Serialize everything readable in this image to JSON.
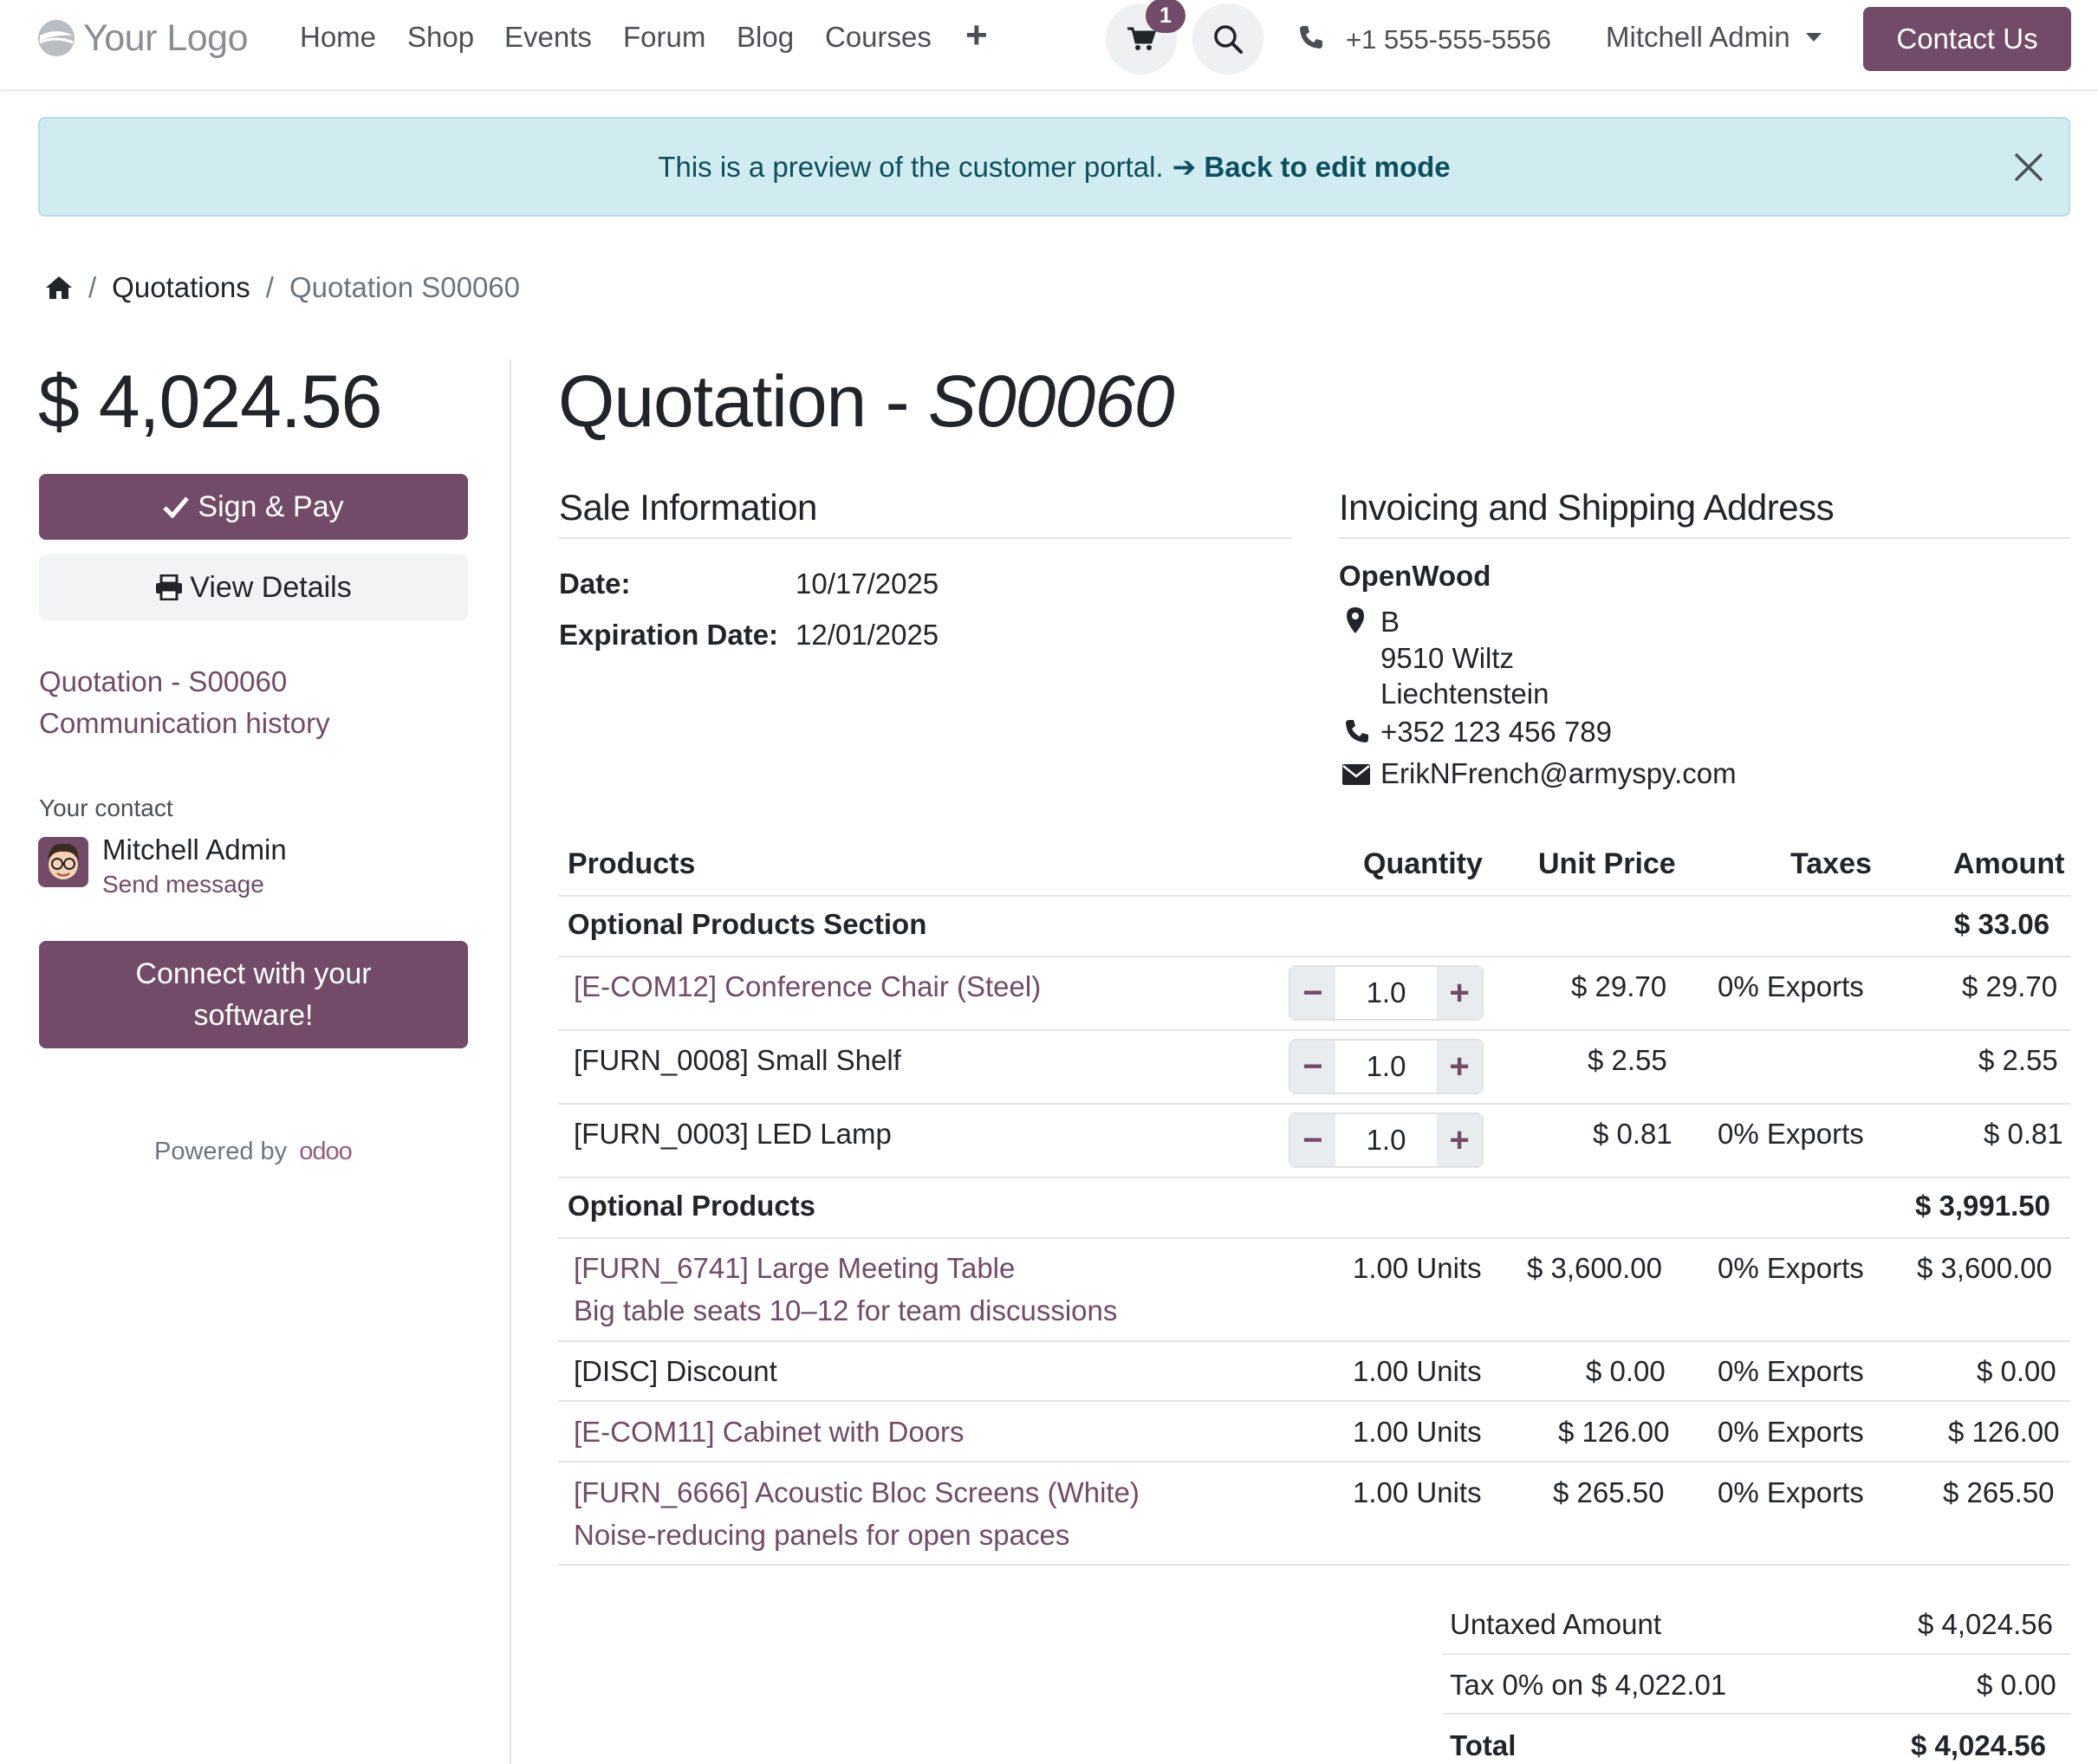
{
  "header": {
    "logo_text": "Your Logo",
    "nav": [
      "Home",
      "Shop",
      "Events",
      "Forum",
      "Blog",
      "Courses",
      "+"
    ],
    "cart_count": "1",
    "phone": "+1 555-555-5556",
    "user": "Mitchell Admin",
    "contact_label": "Contact Us"
  },
  "banner": {
    "text": "This is a preview of the customer portal.",
    "arrow": "➔",
    "link": "Back to edit mode"
  },
  "breadcrumb": {
    "sep": "/",
    "level1": "Quotations",
    "current": "Quotation S00060"
  },
  "sidebar": {
    "amount": "$ 4,024.56",
    "sign_pay": "Sign & Pay",
    "view_details": "View Details",
    "link_quotation": "Quotation - S00060",
    "link_history": "Communication history",
    "contact_label": "Your contact",
    "contact_name": "Mitchell Admin",
    "send_message": "Send message",
    "connect_line1": "Connect with your",
    "connect_line2": "software!",
    "powered_by": "Powered by",
    "powered_brand": "odoo"
  },
  "document": {
    "title_prefix": "Quotation - ",
    "title_ref": "S00060",
    "sale_info_title": "Sale Information",
    "date_label": "Date:",
    "date_value": "10/17/2025",
    "exp_label": "Expiration Date:",
    "exp_value": "12/01/2025",
    "address_title": "Invoicing and Shipping Address",
    "customer": "OpenWood",
    "address": [
      "B",
      "9510 Wiltz",
      "Liechtenstein"
    ],
    "phone": "+352 123 456 789",
    "email": "ErikNFrench@armyspy.com"
  },
  "table": {
    "headers": {
      "product": "Products",
      "quantity": "Quantity",
      "unit_price": "Unit Price",
      "taxes": "Taxes",
      "amount": "Amount"
    },
    "section1": {
      "name": "Optional Products Section",
      "total": "$ 33.06"
    },
    "rows1": [
      {
        "name": "[E-COM12] Conference Chair (Steel)",
        "qty": "1.0",
        "price": "$ 29.70",
        "taxes": "0% Exports",
        "amount": "$ 29.70"
      },
      {
        "name": "[FURN_0008] Small Shelf",
        "qty": "1.0",
        "price": "$ 2.55",
        "taxes": "",
        "amount": "$ 2.55"
      },
      {
        "name": "[FURN_0003] LED Lamp",
        "qty": "1.0",
        "price": "$ 0.81",
        "taxes": "0% Exports",
        "amount": "$ 0.81"
      }
    ],
    "section2": {
      "name": "Optional Products",
      "total": "$ 3,991.50"
    },
    "rows2": [
      {
        "name": "[FURN_6741] Large Meeting Table",
        "desc": "Big table seats 10–12 for team discussions",
        "qty": "1.00 Units",
        "price": "$ 3,600.00",
        "taxes": "0% Exports",
        "amount": "$ 3,600.00"
      },
      {
        "name": "[DISC] Discount",
        "qty": "1.00 Units",
        "price": "$ 0.00",
        "taxes": "0% Exports",
        "amount": "$ 0.00"
      },
      {
        "name": "[E-COM11] Cabinet with Doors",
        "qty": "1.00 Units",
        "price": "$ 126.00",
        "taxes": "0% Exports",
        "amount": "$ 126.00"
      },
      {
        "name": "[FURN_6666] Acoustic Bloc Screens (White)",
        "desc": "Noise-reducing panels for open spaces",
        "qty": "1.00 Units",
        "price": "$ 265.50",
        "taxes": "0% Exports",
        "amount": "$ 265.50"
      }
    ]
  },
  "totals": {
    "untaxed_label": "Untaxed Amount",
    "untaxed_value": "$ 4,024.56",
    "tax_label": "Tax 0% on $ 4,022.01",
    "tax_value": "$ 0.00",
    "total_label": "Total",
    "total_value": "$ 4,024.56"
  },
  "colors": {
    "brand": "#714b67",
    "banner_bg": "#d1ecf1",
    "banner_text": "#0c4f5c"
  },
  "icons": [
    "cart-icon",
    "search-icon",
    "phone-icon",
    "caret-down-icon",
    "arrow-right-icon",
    "close-icon",
    "home-icon",
    "check-icon",
    "print-icon",
    "map-marker-icon",
    "envelope-icon",
    "minus-icon",
    "plus-icon",
    "avatar"
  ]
}
